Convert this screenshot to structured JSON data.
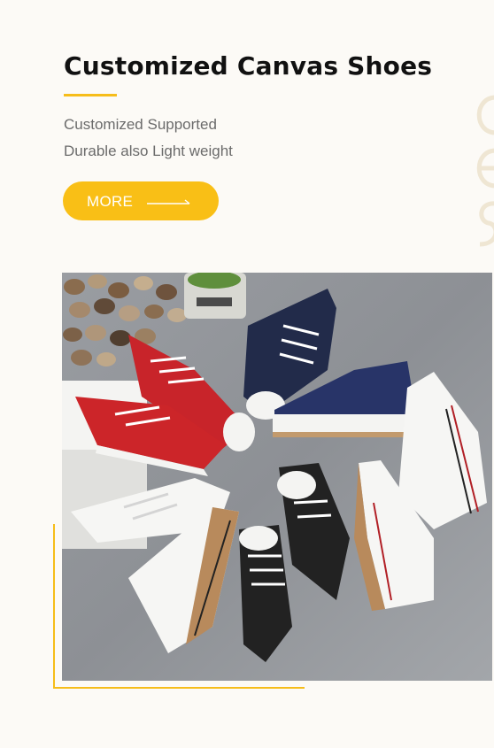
{
  "hero": {
    "title": "Customized Canvas Shoes",
    "subtitle_lines": [
      "Customized Supported",
      "Durable also Light weight"
    ],
    "more_button": {
      "label": "MORE"
    }
  },
  "colors": {
    "accent": "#f6bd1a",
    "button": "#f9bf16",
    "background": "#fcfaf6",
    "title": "#111111",
    "subtitle": "#6b6b6b"
  },
  "icons": {
    "arrow": "arrow-right-icon"
  }
}
